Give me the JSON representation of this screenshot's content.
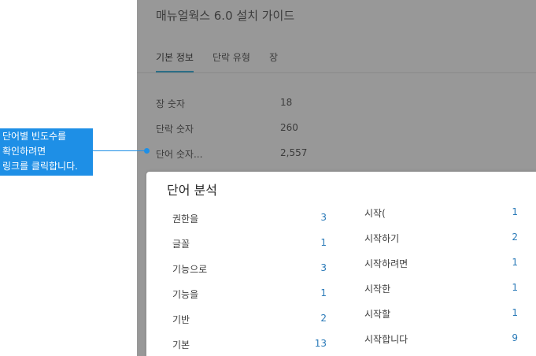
{
  "doc_title": "매뉴얼웍스 6.0 설치 가이드",
  "tabs": [
    {
      "label": "기본 정보",
      "active": true
    },
    {
      "label": "단락 유형",
      "active": false
    },
    {
      "label": "장",
      "active": false
    }
  ],
  "stats": [
    {
      "label": "장 숫자",
      "value": "18"
    },
    {
      "label": "단락 숫자",
      "value": "260"
    },
    {
      "label": "단어 숫자...",
      "value": "2,557"
    }
  ],
  "word_analysis": {
    "title": "단어 분석",
    "left_column": [
      {
        "word": "권한을",
        "count": "3"
      },
      {
        "word": "글꼴",
        "count": "1"
      },
      {
        "word": "기능으로",
        "count": "3"
      },
      {
        "word": "기능을",
        "count": "1"
      },
      {
        "word": "기반",
        "count": "2"
      },
      {
        "word": "기본",
        "count": "13"
      }
    ],
    "right_column": [
      {
        "word": "시작(",
        "count": "1"
      },
      {
        "word": "시작하기",
        "count": "2"
      },
      {
        "word": "시작하려면",
        "count": "1"
      },
      {
        "word": "시작한",
        "count": "1"
      },
      {
        "word": "시작할",
        "count": "1"
      },
      {
        "word": "시작합니다",
        "count": "9"
      }
    ]
  },
  "callout": {
    "lines": [
      "단어별 빈도수를",
      "확인하려면",
      "링크를 클릭합니다."
    ]
  },
  "colors": {
    "overlay": "#989898",
    "accent": "#1e8fe6",
    "count_text": "#2a7ab8",
    "tab_underline": "#2c6e86"
  }
}
